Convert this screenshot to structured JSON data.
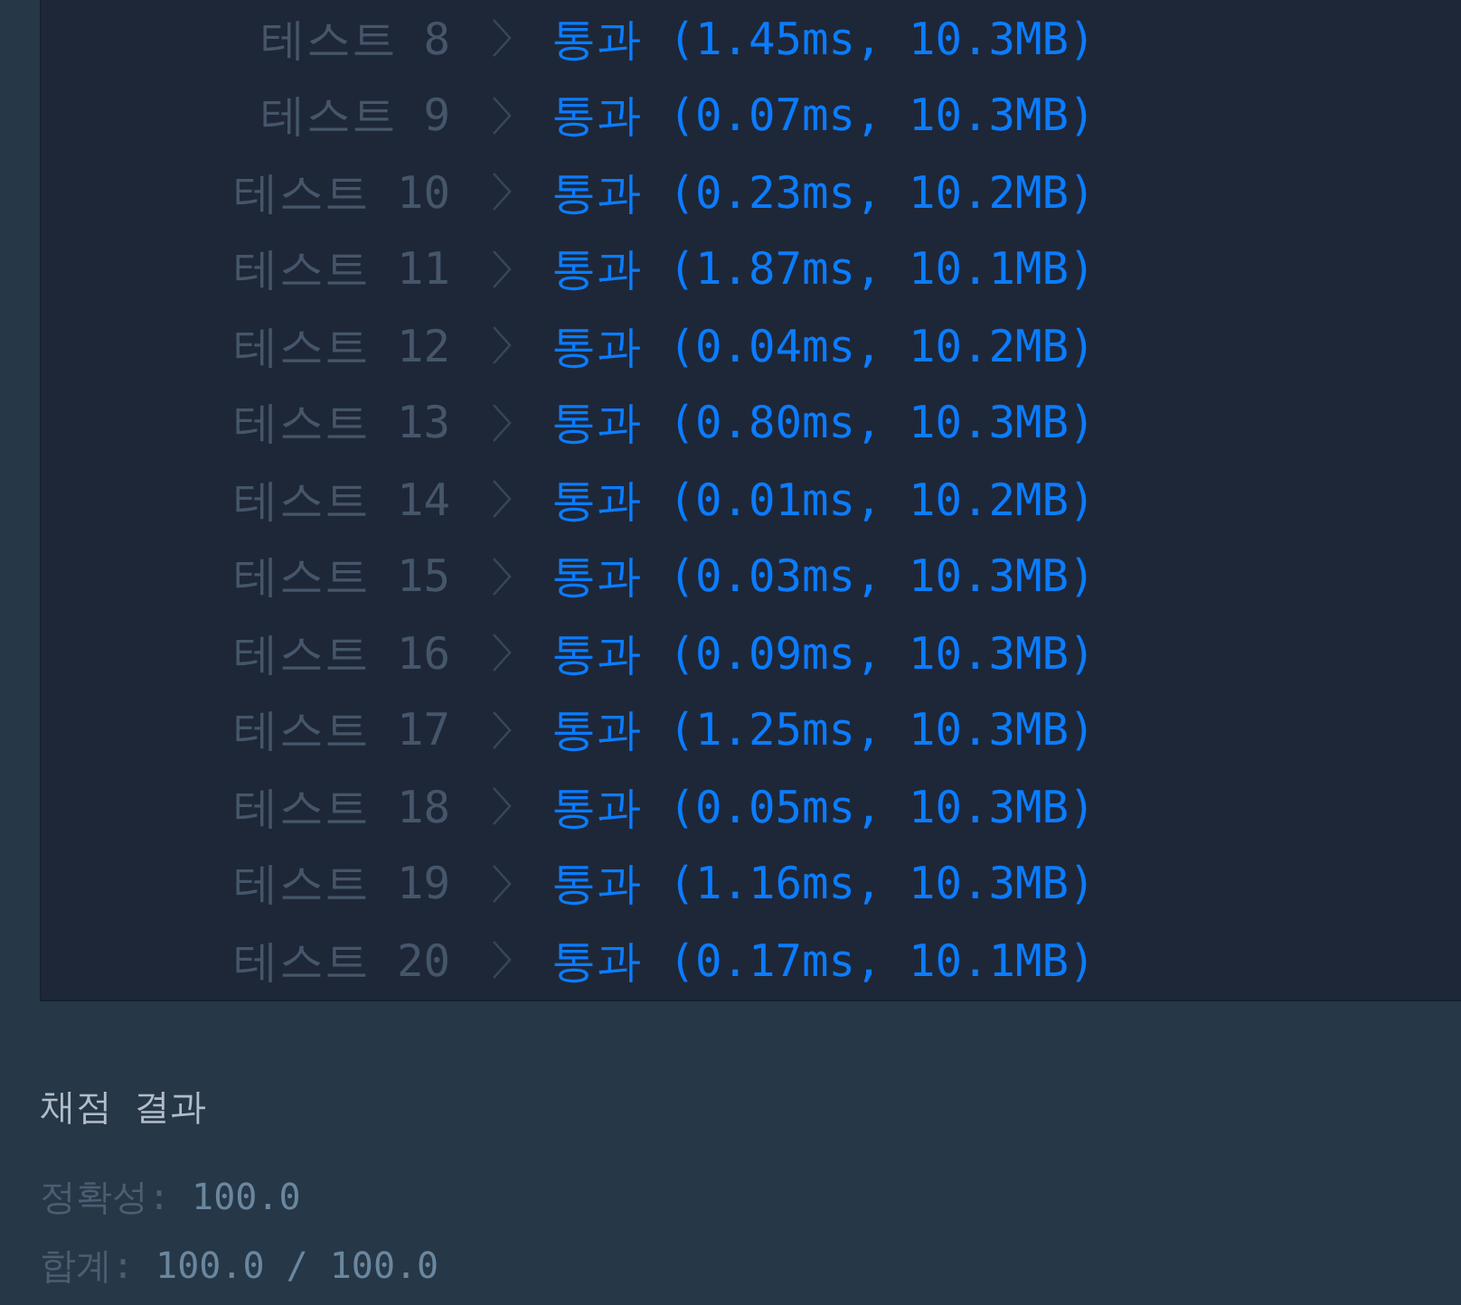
{
  "tests": [
    {
      "label": "테스트 8",
      "result": "통과 (1.45ms, 10.3MB)"
    },
    {
      "label": "테스트 9",
      "result": "통과 (0.07ms, 10.3MB)"
    },
    {
      "label": "테스트 10",
      "result": "통과 (0.23ms, 10.2MB)"
    },
    {
      "label": "테스트 11",
      "result": "통과 (1.87ms, 10.1MB)"
    },
    {
      "label": "테스트 12",
      "result": "통과 (0.04ms, 10.2MB)"
    },
    {
      "label": "테스트 13",
      "result": "통과 (0.80ms, 10.3MB)"
    },
    {
      "label": "테스트 14",
      "result": "통과 (0.01ms, 10.2MB)"
    },
    {
      "label": "테스트 15",
      "result": "통과 (0.03ms, 10.3MB)"
    },
    {
      "label": "테스트 16",
      "result": "통과 (0.09ms, 10.3MB)"
    },
    {
      "label": "테스트 17",
      "result": "통과 (1.25ms, 10.3MB)"
    },
    {
      "label": "테스트 18",
      "result": "통과 (0.05ms, 10.3MB)"
    },
    {
      "label": "테스트 19",
      "result": "통과 (1.16ms, 10.3MB)"
    },
    {
      "label": "테스트 20",
      "result": "통과 (0.17ms, 10.1MB)"
    }
  ],
  "grading": {
    "title": "채점 결과",
    "lines": [
      {
        "label": "정확성:",
        "value": "100.0"
      },
      {
        "label": "합계:",
        "value": "100.0 / 100.0"
      }
    ]
  }
}
